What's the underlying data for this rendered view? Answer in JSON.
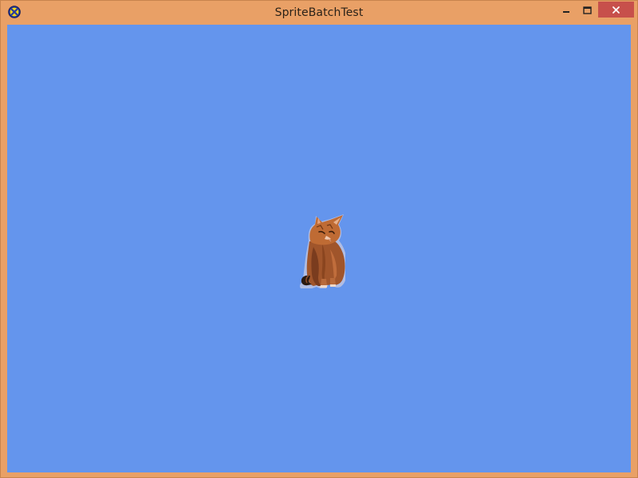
{
  "window": {
    "title": "SpriteBatchTest",
    "frame_color": "#e9a066",
    "close_color": "#c7504b"
  },
  "titlebar": {
    "app_icon": "xna-logo-icon",
    "controls": {
      "minimize_icon": "minimize-icon",
      "maximize_icon": "maximize-icon",
      "close_icon": "close-icon"
    }
  },
  "canvas": {
    "background_color": "#6495ed",
    "sprite": "cat-sprite"
  }
}
